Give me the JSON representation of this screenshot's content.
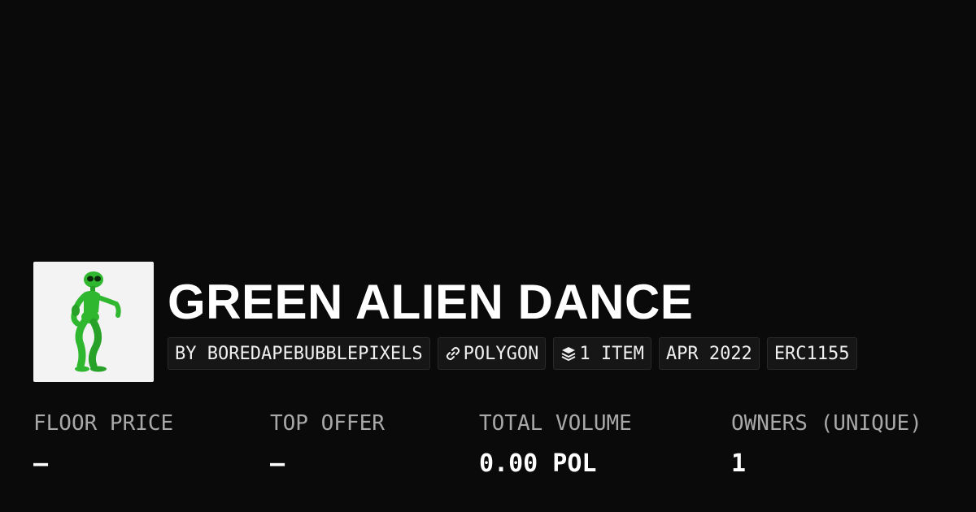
{
  "collection": {
    "name": "GREEN ALIEN DANCE",
    "image_subject": "green alien dancing"
  },
  "tags": {
    "creator": "BY BOREDAPEBUBBLEPIXELS",
    "chain": "POLYGON",
    "chain_icon": "link-icon",
    "items": "1 ITEM",
    "items_icon": "layers-icon",
    "date": "APR 2022",
    "standard": "ERC1155"
  },
  "stats": {
    "floor_price": {
      "label": "FLOOR PRICE",
      "value": "–"
    },
    "top_offer": {
      "label": "TOP OFFER",
      "value": "–"
    },
    "total_volume": {
      "label": "TOTAL VOLUME",
      "value": "0.00 POL"
    },
    "owners": {
      "label": "OWNERS (UNIQUE)",
      "value": "1"
    }
  },
  "colors": {
    "background": "#0a0a0a",
    "tag_background": "#161616",
    "label_gray": "#a8a8a8",
    "alien_green": "#2fb82f"
  }
}
